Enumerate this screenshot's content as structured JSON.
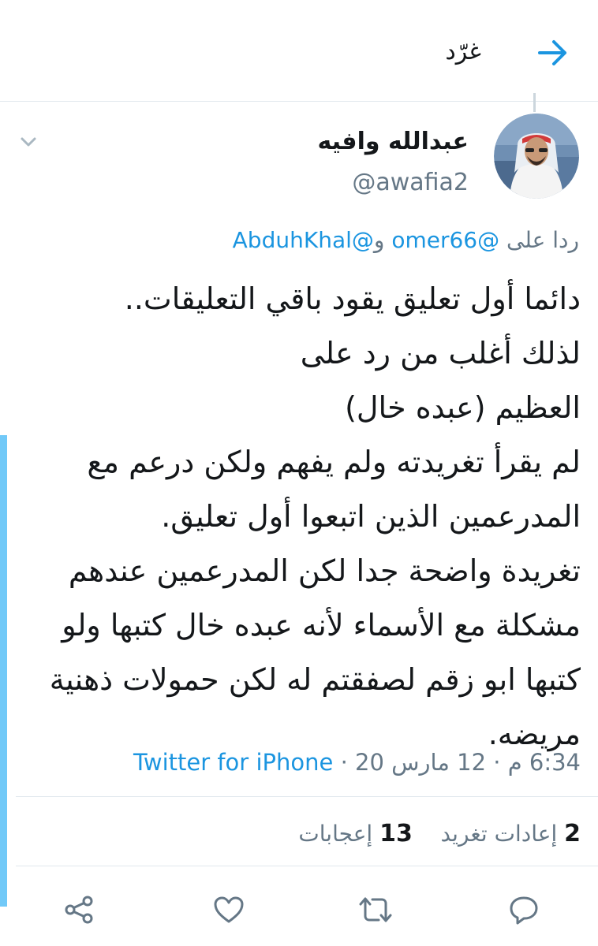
{
  "header": {
    "title": "غرّد",
    "back_icon": "arrow-icon"
  },
  "author": {
    "name": "عبدالله وافيه",
    "handle": "@awafia2"
  },
  "reply": {
    "prefix": "ردا على",
    "mention_1": "@omer66",
    "conjunction": "و",
    "mention_2": "@AbduhKhal"
  },
  "tweet": {
    "lines": [
      "دائما أول تعليق يقود باقي التعليقات..",
      "لذلك أغلب من رد على",
      "العظيم (عبده خال)",
      "لم يقرأ تغريدته ولم يفهم ولكن درعم مع",
      "المدرعمين الذين اتبعوا أول تعليق.",
      "تغريدة واضحة جدا لكن  المدرعمين عندهم",
      "مشكلة مع الأسماء لأنه عبده خال كتبها ولو",
      "كتبها ابو زقم لصفقتم له لكن حمولات ذهنية",
      "مريضه."
    ]
  },
  "meta": {
    "time": "6:34 م",
    "sep": "·",
    "date": "12 مارس 20",
    "source": "Twitter for iPhone"
  },
  "stats": {
    "retweets_count": "2",
    "retweets_label": "إعادات تغريد",
    "likes_count": "13",
    "likes_label": "إعجابات"
  },
  "actions": [
    "reply-icon",
    "retweet-icon",
    "like-icon",
    "share-icon"
  ],
  "colors": {
    "accent": "#1b95e0",
    "secondary_text": "#657786",
    "divider": "#e1e8ed",
    "side_bar": "#71c9f8"
  }
}
